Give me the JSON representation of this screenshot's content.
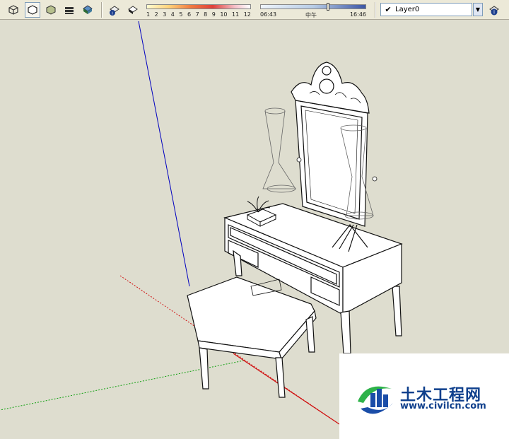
{
  "toolbar": {
    "style_buttons": [
      "xray-icon",
      "wireframe-icon",
      "hidden-line-icon",
      "shaded-icon",
      "shaded-textures-icon"
    ],
    "shadow_buttons": [
      "shadow-settings-icon",
      "display-shadows-icon"
    ],
    "shadow_ticks": [
      "1",
      "2",
      "3",
      "4",
      "5",
      "6",
      "7",
      "8",
      "9",
      "10",
      "11",
      "12"
    ],
    "time_start": "06:43",
    "time_mid": "中午",
    "time_end": "16:46",
    "layer_name": "Layer0",
    "layer_check": "✔"
  },
  "watermark": {
    "title": "土木工程网",
    "url": "www.civilcn.com"
  },
  "colors": {
    "background": "#deddcf",
    "toolbar": "#ece9d8",
    "axis_blue": "#0000c0",
    "axis_red": "#d01010",
    "axis_green": "#10a010",
    "brand_blue": "#0e3f8c"
  }
}
